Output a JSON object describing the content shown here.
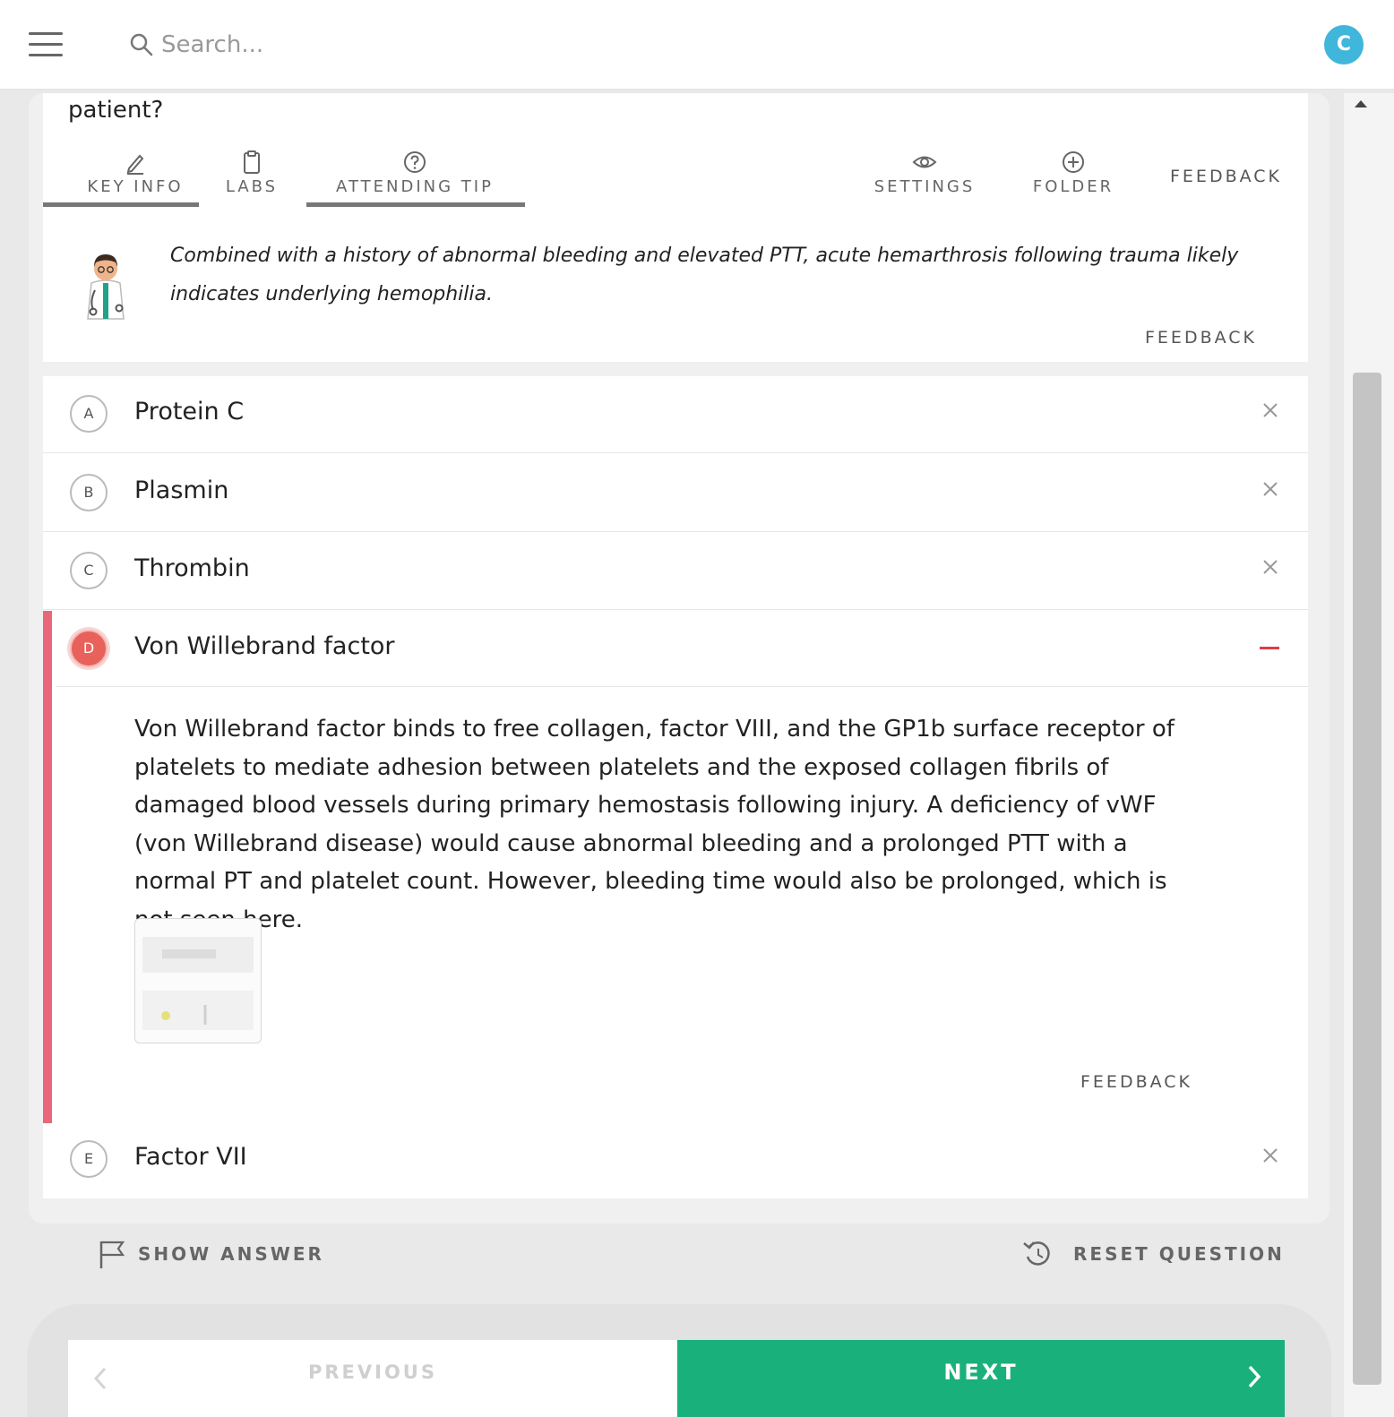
{
  "header": {
    "search_placeholder": "Search...",
    "avatar_initial": "C",
    "avatar_color": "#3fb6da"
  },
  "question": {
    "tail_text": "patient?"
  },
  "toolbar": {
    "key_info": "KEY INFO",
    "labs": "LABS",
    "attending_tip": "ATTENDING TIP",
    "settings": "SETTINGS",
    "folder": "FOLDER",
    "feedback": "FEEDBACK"
  },
  "attending_tip": {
    "text": "Combined with a history of abnormal bleeding and elevated PTT, acute hemarthrosis following trauma likely indicates underlying hemophilia.",
    "feedback": "FEEDBACK"
  },
  "options": [
    {
      "letter": "A",
      "text": "Protein C"
    },
    {
      "letter": "B",
      "text": "Plasmin"
    },
    {
      "letter": "C",
      "text": "Thrombin"
    },
    {
      "letter": "D",
      "text": "Von Willebrand factor"
    },
    {
      "letter": "E",
      "text": "Factor VII"
    }
  ],
  "explanation": {
    "text": "Von Willebrand factor binds to free collagen, factor VIII, and the GP1b surface receptor of platelets to mediate adhesion between platelets and the exposed collagen fibrils of damaged blood vessels during primary hemostasis following injury. A deficiency of vWF (von Willebrand disease) would cause abnormal bleeding and a prolonged PTT with a normal PT and platelet count. However, bleeding time would also be prolonged, which is not seen here.",
    "feedback": "FEEDBACK"
  },
  "actions": {
    "show_answer": "SHOW ANSWER",
    "reset_question": "RESET QUESTION"
  },
  "navigation": {
    "previous": "PREVIOUS",
    "next": "NEXT"
  },
  "colors": {
    "selected_red": "#e8615b",
    "next_green": "#19b07c"
  }
}
